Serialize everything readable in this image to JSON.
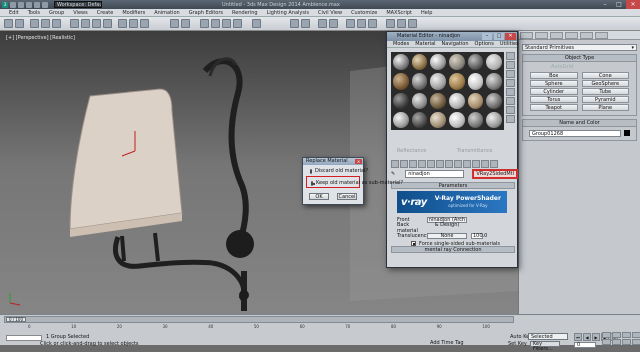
{
  "titlebar": {
    "logo_text": "3",
    "workspace": "Workspace: Default",
    "title": "Untitled - 3ds Max Design 2014    Ambience.max",
    "min_glyph": "–",
    "max_glyph": "□",
    "close_glyph": "✕"
  },
  "menubar": {
    "items": [
      "Edit",
      "Tools",
      "Group",
      "Views",
      "Create",
      "Modifiers",
      "Animation",
      "Graph Editors",
      "Rendering",
      "Lighting Analysis",
      "Civil View",
      "Customize",
      "MAXScript",
      "Help"
    ]
  },
  "viewport": {
    "label": "[+] [Perspective] [Realistic]"
  },
  "command_panel": {
    "dropdown": "Standard Primitives",
    "object_type_header": "Object Type",
    "autogrid": "AutoGrid",
    "buttons": [
      "Box",
      "Cone",
      "Sphere",
      "GeoSphere",
      "Cylinder",
      "Tube",
      "Torus",
      "Pyramid",
      "Teapot",
      "Plane"
    ],
    "name_color_header": "Name and Color",
    "name_value": "Group01268"
  },
  "material_editor": {
    "title": "Material Editor - ninadjon",
    "menu": [
      "Modes",
      "Material",
      "Navigation",
      "Options",
      "Utilities"
    ],
    "reflectance": "Reflectance",
    "transmittance": "Transmittance",
    "material_name": "ninadjon",
    "type_button": "VRay2SidedMtl",
    "parameters_header": "Parameters",
    "banner_logo": "v·ray",
    "banner_title": "V-Ray PowerShader",
    "banner_sub": "optimized for V-Ray",
    "front_label": "Front",
    "front_value": "ninadjon  (Arch & Design)",
    "back_label": "Back material",
    "translucency_label": "Translucency:",
    "translucency_value": "None",
    "translucency_num": "100.0",
    "force_label": "Force single-sided sub-materials",
    "connection": "mental ray Connection"
  },
  "replace_dialog": {
    "title": "Replace Material",
    "option1": "Discard old material?",
    "option2": "Keep old material as sub-material?",
    "ok": "OK",
    "cancel": "Cancel"
  },
  "status": {
    "timeslider": "0 / 100",
    "ticks": [
      "0",
      "10",
      "20",
      "30",
      "40",
      "50",
      "60",
      "70",
      "80",
      "90",
      "100"
    ],
    "selected": "1 Group Selected",
    "prompt": "Click or click-and-drag to select objects",
    "add_time_tag": "Add Time Tag",
    "auto_key": "Auto Key",
    "set_key": "Set Key",
    "selected_dd": "Selected",
    "key_filters": "Key Filters...",
    "frame": "0"
  }
}
